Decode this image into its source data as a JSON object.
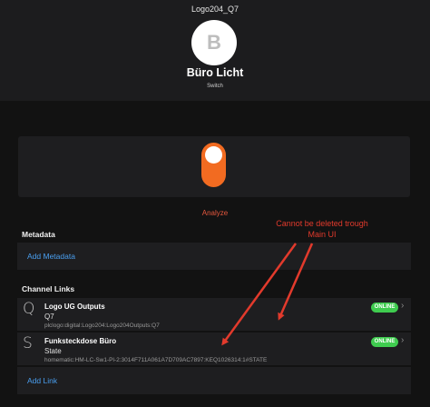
{
  "header": {
    "title": "Logo204_Q7",
    "avatar_letter": "B",
    "device_name": "Büro Licht",
    "device_type": "Switch"
  },
  "toggle": {
    "state": "on",
    "color": "#f26b21"
  },
  "analyze_label": "Analyze",
  "annotation": {
    "line1": "Cannot be deleted trough",
    "line2": "Main UI",
    "color": "#e23a2c"
  },
  "metadata": {
    "title": "Metadata",
    "add_label": "Add Metadata"
  },
  "channel_links": {
    "title": "Channel Links",
    "items": [
      {
        "letter": "Q",
        "title": "Logo UG Outputs",
        "subtitle": "Q7",
        "id": "plclogo:digital:Logo204:Logo204Outputs:Q7",
        "status": "ONLINE"
      },
      {
        "letter": "S",
        "title": "Funksteckdose Büro",
        "subtitle": "State",
        "id": "homematic:HM-LC-Sw1-Pl-2:3014F711A061A7D709AC7897:KEQ1026314:1#STATE",
        "status": "ONLINE"
      }
    ],
    "add_label": "Add Link"
  },
  "colors": {
    "accent": "#f26b21",
    "link": "#4a9ff0",
    "online": "#3fcc4f",
    "background": "#121212",
    "card": "#1e1e20"
  }
}
